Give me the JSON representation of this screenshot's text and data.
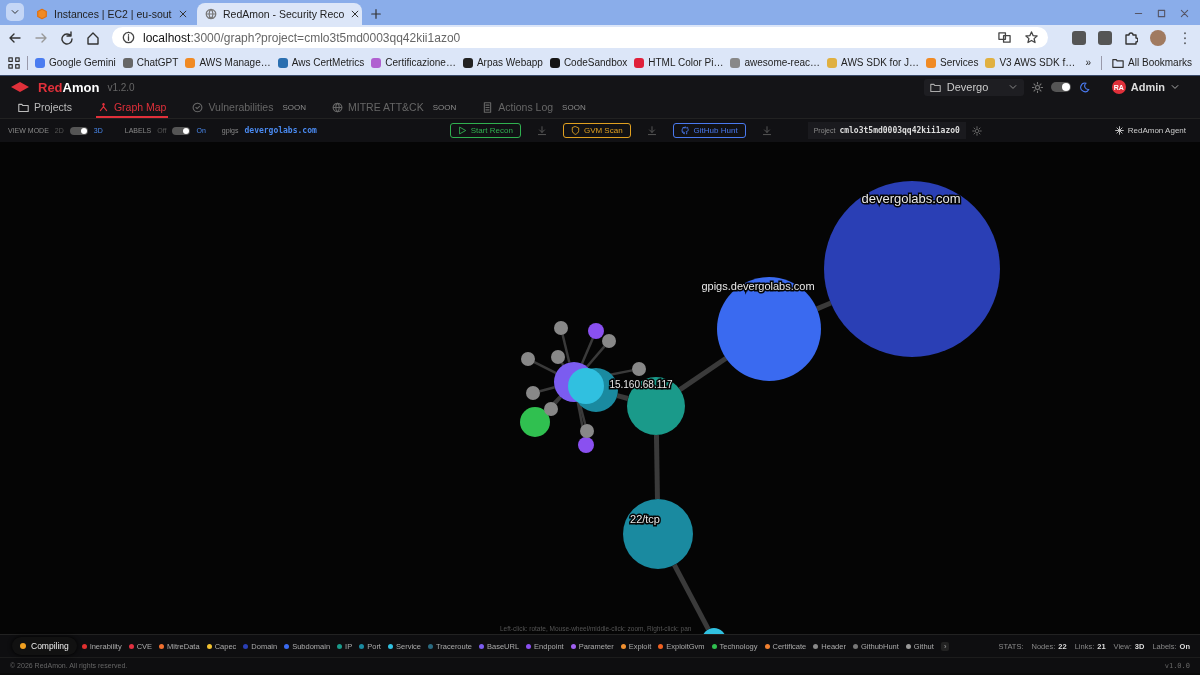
{
  "browser": {
    "tabs": [
      {
        "title": "Instances | EC2 | eu-sout",
        "selected": false
      },
      {
        "title": "RedAmon - Security Reco",
        "selected": true
      }
    ],
    "address": {
      "host": "localhost",
      "path": ":3000/graph?project=cmlo3t5md0003qq42kii1azo0"
    },
    "bookmarks": [
      {
        "label": "Google Gemini",
        "color": "#4a7cf0"
      },
      {
        "label": "ChatGPT",
        "color": "#666666"
      },
      {
        "label": "AWS Manage…",
        "color": "#f08a24"
      },
      {
        "label": "Aws CertMetrics",
        "color": "#2a6fb0"
      },
      {
        "label": "Certificazione…",
        "color": "#b060d0"
      },
      {
        "label": "Arpas Webapp",
        "color": "#222222"
      },
      {
        "label": "CodeSandbox",
        "color": "#151515"
      },
      {
        "label": "HTML Color Pi…",
        "color": "#e0203a"
      },
      {
        "label": "awesome-reac…",
        "color": "#888888"
      },
      {
        "label": "AWS SDK for J…",
        "color": "#e0b040"
      },
      {
        "label": "Services",
        "color": "#f08a24"
      },
      {
        "label": "V3 AWS SDK f…",
        "color": "#e0b040"
      }
    ],
    "more": "»",
    "all_bookmarks": "All Bookmarks"
  },
  "header": {
    "logo_1": "Red",
    "logo_2": "Amon",
    "version": "v1.2.0",
    "project": "Devergo",
    "dark_mode": true,
    "user": {
      "initials": "RA",
      "name": "Admin"
    }
  },
  "nav": [
    {
      "label": "Projects",
      "selected": false,
      "disabled": false
    },
    {
      "label": "Graph Map",
      "selected": true,
      "disabled": false
    },
    {
      "label": "Vulnerabilities",
      "selected": false,
      "disabled": true,
      "badge": "SOON"
    },
    {
      "label": "MITRE ATT&CK",
      "selected": false,
      "disabled": true,
      "badge": "SOON"
    },
    {
      "label": "Actions Log",
      "selected": false,
      "disabled": true,
      "badge": "SOON"
    }
  ],
  "toolbar": {
    "view_mode": {
      "label": "VIEW MODE",
      "off": "2D",
      "on_text": "3D",
      "on": true
    },
    "labels": {
      "label": "LABELS",
      "off": "Off",
      "on_text": "On",
      "on": true
    },
    "target": {
      "prefix": "gpigs",
      "domain": "devergolabs.com"
    },
    "actions": [
      {
        "label": "Start Recon",
        "kind": "recon"
      },
      {
        "label": "GVM Scan",
        "kind": "gvm"
      },
      {
        "label": "GitHub Hunt",
        "kind": "github"
      }
    ],
    "project": {
      "label": "Project",
      "id": "cmlo3t5md0003qq42kii1azo0"
    },
    "agent": "RedAmon Agent"
  },
  "graph": {
    "nodes": [
      {
        "kind": "domain",
        "label": "devergolabs.com"
      },
      {
        "kind": "subdomain",
        "label": "gpigs.devergolabs.com"
      },
      {
        "kind": "ip",
        "label": "15.160.68.117"
      },
      {
        "kind": "port",
        "label": "22/tcp"
      },
      {
        "kind": "port"
      },
      {
        "kind": "service"
      },
      {
        "kind": "baseurl"
      },
      {
        "kind": "technology"
      },
      {
        "kind": "header"
      },
      {
        "kind": "header"
      },
      {
        "kind": "header"
      },
      {
        "kind": "header"
      },
      {
        "kind": "header"
      },
      {
        "kind": "header"
      },
      {
        "kind": "header"
      },
      {
        "kind": "header"
      },
      {
        "kind": "endpoint"
      },
      {
        "kind": "endpoint"
      },
      {
        "kind": "service"
      }
    ],
    "hint": "Left-click: rotate, Mouse-wheel/middle-click: zoom, Right-click: pan"
  },
  "legend": {
    "items": [
      {
        "label": "lnerability",
        "color": "#e03030"
      },
      {
        "label": "CVE",
        "color": "#e03040"
      },
      {
        "label": "MitreData",
        "color": "#f07030"
      },
      {
        "label": "Capec",
        "color": "#f0c030"
      },
      {
        "label": "Domain",
        "color": "#2a3fb5"
      },
      {
        "label": "Subdomain",
        "color": "#3a6af0"
      },
      {
        "label": "IP",
        "color": "#1a9a8a"
      },
      {
        "label": "Port",
        "color": "#1a8aa0"
      },
      {
        "label": "Service",
        "color": "#30c0e0"
      },
      {
        "label": "Traceroute",
        "color": "#2a6a80"
      },
      {
        "label": "BaseURL",
        "color": "#7b5cf0"
      },
      {
        "label": "Endpoint",
        "color": "#8a50f0"
      },
      {
        "label": "Parameter",
        "color": "#a060f0"
      },
      {
        "label": "Exploit",
        "color": "#f09030"
      },
      {
        "label": "ExploitGvm",
        "color": "#f06020"
      },
      {
        "label": "Technology",
        "color": "#30c050"
      },
      {
        "label": "Certificate",
        "color": "#f08030"
      },
      {
        "label": "Header",
        "color": "#888888"
      },
      {
        "label": "GithubHunt",
        "color": "#777777"
      },
      {
        "label": "Githut",
        "color": "#999999"
      }
    ],
    "more": "›",
    "stats": {
      "label": "STATS:",
      "items": [
        {
          "label": "Nodes:",
          "value": "22"
        },
        {
          "label": "Links:",
          "value": "21"
        },
        {
          "label": "View:",
          "value": "3D"
        },
        {
          "label": "Labels:",
          "value": "On"
        }
      ]
    }
  },
  "toast": "Compiling",
  "footer": {
    "copyright": "© 2026 RedAmon. All rights reserved.",
    "version": "v1.0.0"
  }
}
